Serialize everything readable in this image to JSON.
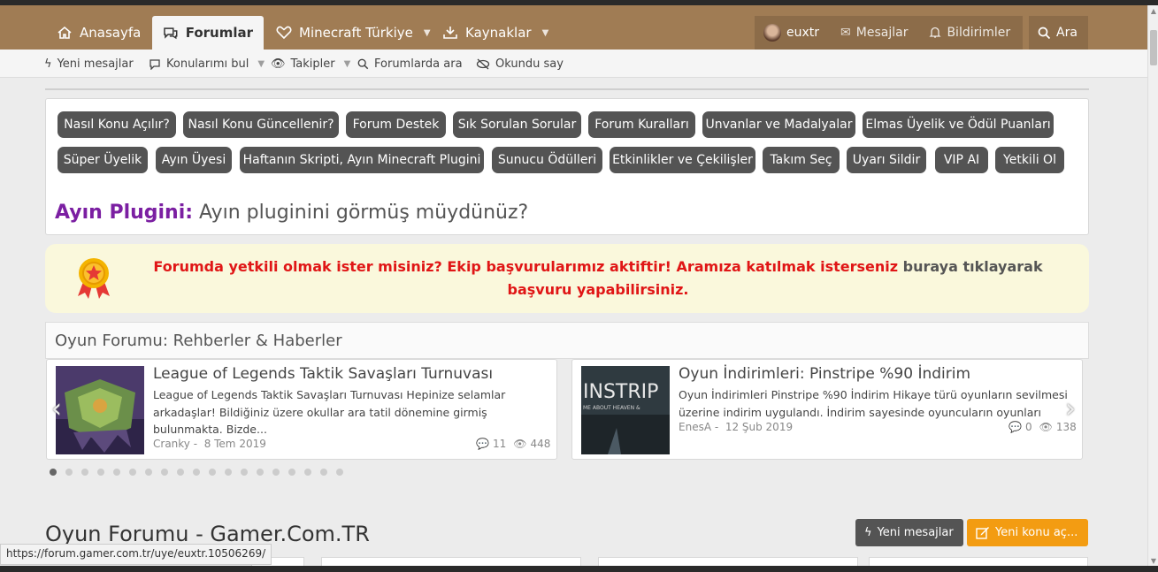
{
  "nav": {
    "home": "Anasayfa",
    "forums": "Forumlar",
    "minecraft": "Minecraft Türkiye",
    "resources": "Kaynaklar",
    "user": "euxtr",
    "messages": "Mesajlar",
    "notifications": "Bildirimler",
    "search": "Ara"
  },
  "subnav": {
    "new_messages": "Yeni mesajlar",
    "find_threads": "Konularımı bul",
    "watched": "Takipler",
    "search_forums": "Forumlarda ara",
    "mark_read": "Okundu say"
  },
  "quick_links": [
    "Nasıl Konu Açılır?",
    "Nasıl Konu Güncellenir?",
    "Forum Destek",
    "Sık Sorulan Sorular",
    "Forum Kuralları",
    "Unvanlar ve Madalyalar",
    "Elmas Üyelik ve Ödül Puanları",
    "Süper Üyelik",
    "Ayın Üyesi",
    "Haftanın Skripti, Ayın Minecraft Plugini",
    "Sunucu Ödülleri",
    "Etkinlikler ve Çekilişler",
    "Takım Seç",
    "Uyarı Sildir",
    "VIP AI",
    "Yetkili Ol"
  ],
  "plugin_promo": {
    "label": "Ayın Plugini:",
    "text": " Ayın pluginini görmüş müydünüz?"
  },
  "recruit": {
    "text": "Forumda yetkili olmak ister misiniz? Ekip başvurularımız aktiftir! Aramıza katılmak isterseniz ",
    "link": "buraya tıklayarak",
    "suffix": " başvuru yapabilirsiniz."
  },
  "section": {
    "title": "Oyun Forumu: Rehberler & Haberler"
  },
  "cards": [
    {
      "title": "League of Legends Taktik Savaşları Turnuvası",
      "desc": "League of Legends Taktik Savaşları Turnuvası Hepinize selamlar arkadaşlar! Bildiğiniz üzere okullar ara tatil dönemine girmiş bulunmakta. Bizde...",
      "author": "Cranky",
      "date": "8 Tem 2019",
      "replies": "11",
      "views": "448"
    },
    {
      "title": "Oyun İndirimleri: Pinstripe %90 İndirim",
      "desc": "Oyun İndirimleri Pinstripe %90 İndirim Hikaye türü oyunların sevilmesi üzerine indirim uygulandı. İndirim sayesinde oyuncuların oyunları satın...",
      "author": "EnesA",
      "date": "12 Şub 2019",
      "replies": "0",
      "views": "138",
      "thumb_text": "INSTRIP",
      "thumb_subtext": "ME ABOUT HEAVEN &"
    }
  ],
  "carousel": {
    "total_dots": 19,
    "active_index": 0
  },
  "forum": {
    "title": "Oyun Forumu - Gamer.Com.TR",
    "new_messages_btn": "Yeni mesajlar",
    "new_thread_btn": "Yeni konu aç..."
  },
  "status_url": "https://forum.gamer.com.tr/uye/euxtr.10506269/",
  "colors": {
    "nav_brown": "#a07c54",
    "pill_gray": "#545454",
    "accent_orange": "#f39c12",
    "recruit_red": "#e01616",
    "plugin_purple": "#7b1fa2"
  }
}
